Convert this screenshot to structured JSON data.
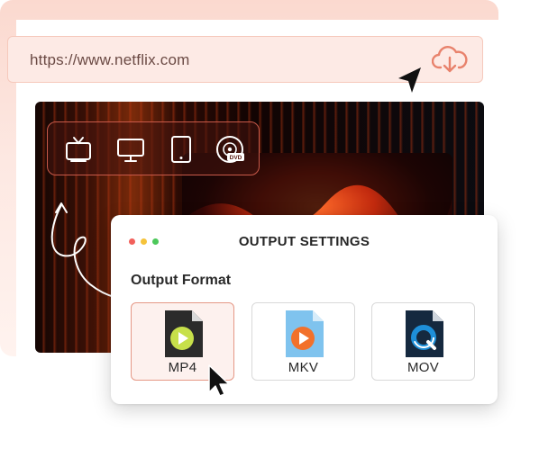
{
  "browser": {
    "url": "https://www.netflix.com",
    "download_icon": "cloud-download-icon"
  },
  "devices": [
    {
      "name": "tv-icon"
    },
    {
      "name": "monitor-icon"
    },
    {
      "name": "tablet-icon"
    },
    {
      "name": "dvd-icon",
      "label": "DVD"
    }
  ],
  "dialog": {
    "title": "OUTPUT SETTINGS",
    "section_label": "Output Format",
    "window_controls": [
      "#f2605b",
      "#f5c33b",
      "#4cc85a"
    ],
    "formats": [
      {
        "label": "MP4",
        "selected": true,
        "icon": "mp4-file-icon",
        "accent": "#c7e04a"
      },
      {
        "label": "MKV",
        "selected": false,
        "icon": "mkv-file-icon",
        "accent": "#f2712b"
      },
      {
        "label": "MOV",
        "selected": false,
        "icon": "mov-file-icon",
        "accent": "#1e8fd8"
      }
    ]
  },
  "colors": {
    "accent": "#e8826c",
    "url_bar_bg": "#fdeae5"
  }
}
